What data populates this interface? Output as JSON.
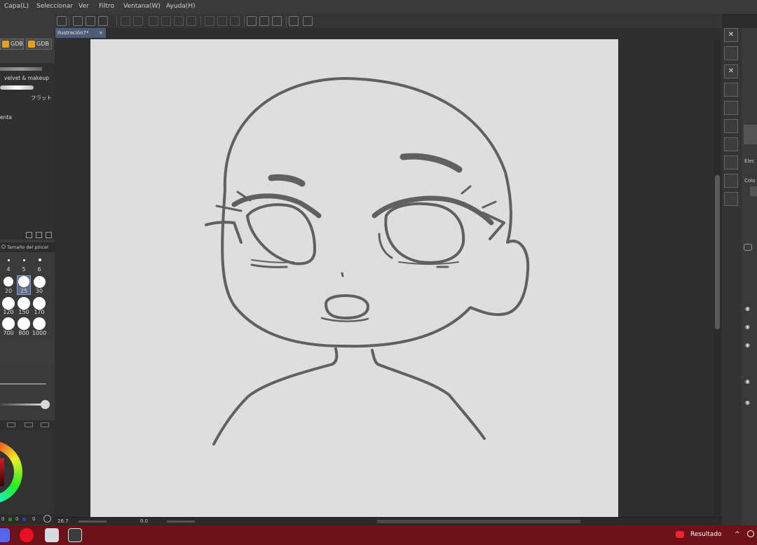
{
  "menu": {
    "items": [
      "Capa(L)",
      "Seleccionar",
      "Ver",
      "Filtro",
      "Ventana(W)",
      "Ayuda(H)"
    ]
  },
  "document": {
    "tab_title": "Ilustración7*",
    "tab_close": "×"
  },
  "subtool": {
    "chips": [
      "GDB",
      "GDB"
    ],
    "brush_names": [
      "velvet & makeup",
      "フラット"
    ],
    "partial_label": "enta"
  },
  "brush_size": {
    "title": "Tamaño del pincel",
    "sizes": [
      "4",
      "5",
      "6",
      "20",
      "25",
      "30",
      "120",
      "150",
      "170",
      "700",
      "800",
      "1000"
    ],
    "selected": "25"
  },
  "color": {
    "values": [
      "0",
      "0",
      "0"
    ]
  },
  "statusbar": {
    "zoom": "26.7",
    "angle": "0.0"
  },
  "right_panel": {
    "label_1": "Elec",
    "label_2": "Colo"
  },
  "taskbar": {
    "result_label": "Resultado"
  }
}
